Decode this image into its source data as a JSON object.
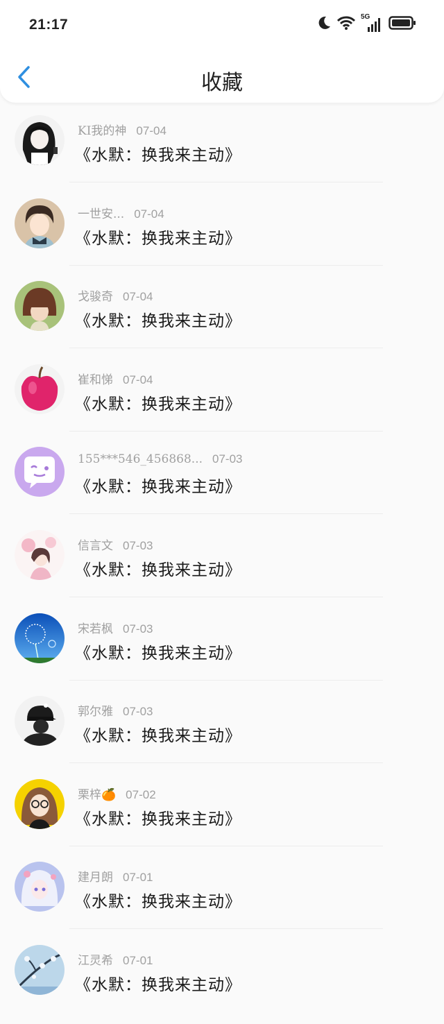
{
  "status_bar": {
    "time": "21:17",
    "network_label": "5G",
    "icons": [
      "moon-icon",
      "wifi-icon",
      "signal-icon",
      "battery-icon"
    ]
  },
  "header": {
    "title": "收藏",
    "back_icon": "chevron-left-icon",
    "accent_color": "#2f8fe0"
  },
  "favorites": [
    {
      "user": "KI我的神",
      "date": "07-04",
      "title": "《水默：换我来主动》",
      "avatar": "girl-bw"
    },
    {
      "user": "一世安...",
      "date": "07-04",
      "title": "《水默：换我来主动》",
      "avatar": "boy-anime"
    },
    {
      "user": "戈骏奇",
      "date": "07-04",
      "title": "《水默：换我来主动》",
      "avatar": "girl-bob"
    },
    {
      "user": "崔和悌",
      "date": "07-04",
      "title": "《水默：换我来主动》",
      "avatar": "apple"
    },
    {
      "user": "155***546_456868...",
      "date": "07-03",
      "title": "《水默：换我来主动》",
      "avatar": "chat-bubble"
    },
    {
      "user": "信言文",
      "date": "07-03",
      "title": "《水默：换我来主动》",
      "avatar": "flower-girl"
    },
    {
      "user": "宋若枫",
      "date": "07-03",
      "title": "《水默：换我来主动》",
      "avatar": "dandelion"
    },
    {
      "user": "郭尔雅",
      "date": "07-03",
      "title": "《水默：换我来主动》",
      "avatar": "cap-person"
    },
    {
      "user": "栗梓🍊",
      "date": "07-02",
      "title": "《水默：换我来主动》",
      "avatar": "glasses-girl"
    },
    {
      "user": "建月朗",
      "date": "07-01",
      "title": "《水默：换我来主动》",
      "avatar": "white-hair-girl"
    },
    {
      "user": "江灵希",
      "date": "07-01",
      "title": "《水默：换我来主动》",
      "avatar": "blossom"
    }
  ]
}
